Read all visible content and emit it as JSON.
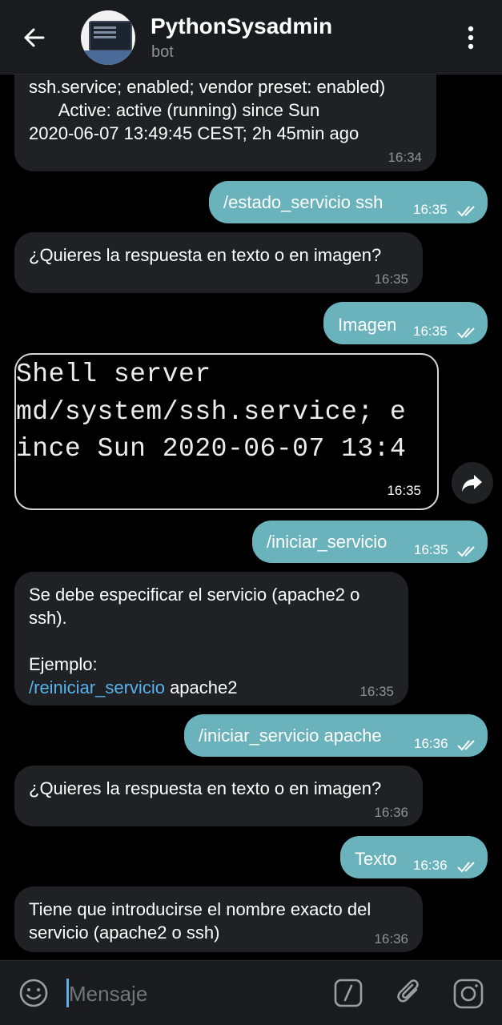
{
  "header": {
    "title": "PythonSysadmin",
    "subtitle": "bot",
    "back_icon": "arrow-left-icon",
    "menu_icon": "more-vertical-icon"
  },
  "messages": [
    {
      "type": "in",
      "text": "ssh.service; enabled; vendor preset: enabled)\n      Active: active (running) since Sun\n2020-06-07 13:49:45 CEST; 2h 45min ago",
      "time": "16:34"
    },
    {
      "type": "out",
      "text": "/estado_servicio ssh",
      "time": "16:35"
    },
    {
      "type": "in",
      "text": "¿Quieres la respuesta en texto o en imagen?",
      "time": "16:35"
    },
    {
      "type": "out",
      "text": "Imagen",
      "time": "16:35"
    },
    {
      "type": "image",
      "lines": [
        "Shell server",
        "md/system/ssh.service; e",
        "ince Sun 2020-06-07 13:4"
      ],
      "time": "16:35"
    },
    {
      "type": "out",
      "text": "/iniciar_servicio",
      "time": "16:35"
    },
    {
      "type": "in",
      "text1": "Se debe especificar el servicio (apache2 o\nssh).\n\nEjemplo:",
      "link": "/reiniciar_servicio",
      "text2": " apache2",
      "time": "16:35"
    },
    {
      "type": "out",
      "text": "/iniciar_servicio apache",
      "time": "16:36"
    },
    {
      "type": "in",
      "text": "¿Quieres la respuesta en texto o en imagen?",
      "time": "16:36"
    },
    {
      "type": "out",
      "text": "Texto",
      "time": "16:36"
    },
    {
      "type": "in",
      "text": "Tiene que introducirse el nombre exacto del\nservicio (apache2 o ssh)",
      "time": "16:36"
    }
  ],
  "composer": {
    "placeholder": "Mensaje",
    "emoji_icon": "emoji-icon",
    "command_icon": "bot-command-icon",
    "attach_icon": "paperclip-icon",
    "camera_icon": "camera-icon"
  },
  "colors": {
    "outgoing_bubble": "#6bb3bc",
    "incoming_bubble": "#1f2124",
    "link": "#57b2ee",
    "header_bg": "#1a1b1e"
  }
}
